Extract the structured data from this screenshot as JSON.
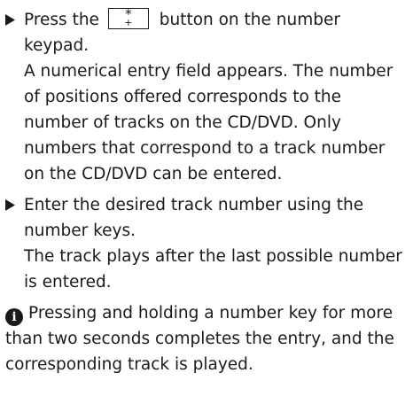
{
  "steps": [
    {
      "text_before_key": "Press the",
      "key_top": "*",
      "key_bottom": "+",
      "text_after_key": "button on the number keypad.",
      "result": "A numerical entry field appears. The number of positions offered corresponds to the number of tracks on the CD/DVD. Only numbers that correspond to a track number on the CD/DVD can be entered."
    },
    {
      "text": "Enter the desired track number using the number keys.",
      "result": "The track plays after the last possible number is entered."
    }
  ],
  "note": {
    "icon": "info-icon",
    "text": "Pressing and holding a number key for more than two seconds completes the entry, and the corresponding track is played."
  }
}
